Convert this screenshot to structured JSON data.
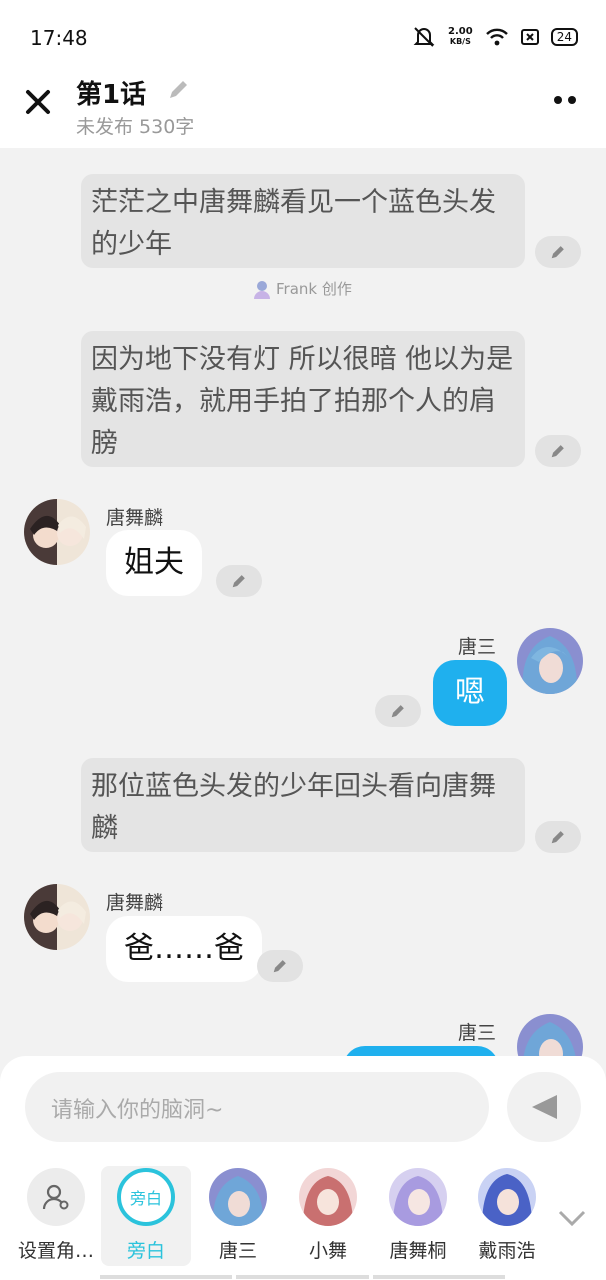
{
  "status": {
    "time": "17:48",
    "speed_value": "2.00",
    "speed_unit": "KB/S",
    "battery": "24"
  },
  "header": {
    "title": "第1话",
    "subtitle": "未发布 530字"
  },
  "messages": {
    "narr1": "茫茫之中唐舞麟看见一个蓝色头发的少年",
    "author": "Frank 创作",
    "narr2": "因为地下没有灯 所以很暗 他以为是戴雨浩，就用手拍了拍那个人的肩膀",
    "m1_name": "唐舞麟",
    "m1_text": "姐夫",
    "m2_name": "唐三",
    "m2_text": "嗯",
    "narr3": "那位蓝色头发的少年回头看向唐舞麟",
    "m3_name": "唐舞麟",
    "m3_text": "爸……爸",
    "m4_name": "唐三"
  },
  "input": {
    "placeholder": "请输入你的脑洞~"
  },
  "characters": [
    {
      "label": "设置角…"
    },
    {
      "label": "旁白",
      "badge": "旁白"
    },
    {
      "label": "唐三"
    },
    {
      "label": "小舞"
    },
    {
      "label": "唐舞桐"
    },
    {
      "label": "戴雨浩"
    }
  ],
  "colors": {
    "accent_blue": "#1fb0ee",
    "narrator_teal": "#2bc3dc"
  }
}
